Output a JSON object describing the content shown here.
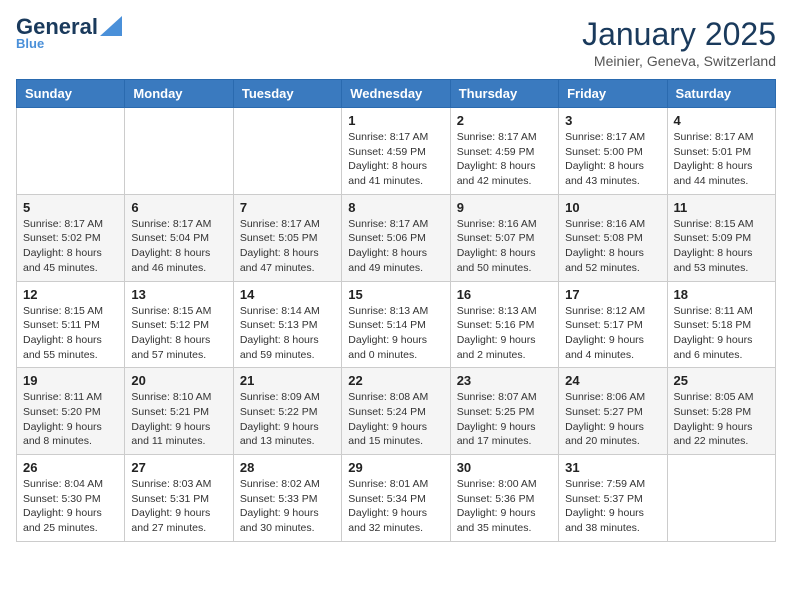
{
  "logo": {
    "general": "General",
    "blue": "Blue"
  },
  "title": "January 2025",
  "location": "Meinier, Geneva, Switzerland",
  "days_of_week": [
    "Sunday",
    "Monday",
    "Tuesday",
    "Wednesday",
    "Thursday",
    "Friday",
    "Saturday"
  ],
  "weeks": [
    [
      {
        "day": "",
        "sunrise": "",
        "sunset": "",
        "daylight": ""
      },
      {
        "day": "",
        "sunrise": "",
        "sunset": "",
        "daylight": ""
      },
      {
        "day": "",
        "sunrise": "",
        "sunset": "",
        "daylight": ""
      },
      {
        "day": "1",
        "sunrise": "Sunrise: 8:17 AM",
        "sunset": "Sunset: 4:59 PM",
        "daylight": "Daylight: 8 hours and 41 minutes."
      },
      {
        "day": "2",
        "sunrise": "Sunrise: 8:17 AM",
        "sunset": "Sunset: 4:59 PM",
        "daylight": "Daylight: 8 hours and 42 minutes."
      },
      {
        "day": "3",
        "sunrise": "Sunrise: 8:17 AM",
        "sunset": "Sunset: 5:00 PM",
        "daylight": "Daylight: 8 hours and 43 minutes."
      },
      {
        "day": "4",
        "sunrise": "Sunrise: 8:17 AM",
        "sunset": "Sunset: 5:01 PM",
        "daylight": "Daylight: 8 hours and 44 minutes."
      }
    ],
    [
      {
        "day": "5",
        "sunrise": "Sunrise: 8:17 AM",
        "sunset": "Sunset: 5:02 PM",
        "daylight": "Daylight: 8 hours and 45 minutes."
      },
      {
        "day": "6",
        "sunrise": "Sunrise: 8:17 AM",
        "sunset": "Sunset: 5:04 PM",
        "daylight": "Daylight: 8 hours and 46 minutes."
      },
      {
        "day": "7",
        "sunrise": "Sunrise: 8:17 AM",
        "sunset": "Sunset: 5:05 PM",
        "daylight": "Daylight: 8 hours and 47 minutes."
      },
      {
        "day": "8",
        "sunrise": "Sunrise: 8:17 AM",
        "sunset": "Sunset: 5:06 PM",
        "daylight": "Daylight: 8 hours and 49 minutes."
      },
      {
        "day": "9",
        "sunrise": "Sunrise: 8:16 AM",
        "sunset": "Sunset: 5:07 PM",
        "daylight": "Daylight: 8 hours and 50 minutes."
      },
      {
        "day": "10",
        "sunrise": "Sunrise: 8:16 AM",
        "sunset": "Sunset: 5:08 PM",
        "daylight": "Daylight: 8 hours and 52 minutes."
      },
      {
        "day": "11",
        "sunrise": "Sunrise: 8:15 AM",
        "sunset": "Sunset: 5:09 PM",
        "daylight": "Daylight: 8 hours and 53 minutes."
      }
    ],
    [
      {
        "day": "12",
        "sunrise": "Sunrise: 8:15 AM",
        "sunset": "Sunset: 5:11 PM",
        "daylight": "Daylight: 8 hours and 55 minutes."
      },
      {
        "day": "13",
        "sunrise": "Sunrise: 8:15 AM",
        "sunset": "Sunset: 5:12 PM",
        "daylight": "Daylight: 8 hours and 57 minutes."
      },
      {
        "day": "14",
        "sunrise": "Sunrise: 8:14 AM",
        "sunset": "Sunset: 5:13 PM",
        "daylight": "Daylight: 8 hours and 59 minutes."
      },
      {
        "day": "15",
        "sunrise": "Sunrise: 8:13 AM",
        "sunset": "Sunset: 5:14 PM",
        "daylight": "Daylight: 9 hours and 0 minutes."
      },
      {
        "day": "16",
        "sunrise": "Sunrise: 8:13 AM",
        "sunset": "Sunset: 5:16 PM",
        "daylight": "Daylight: 9 hours and 2 minutes."
      },
      {
        "day": "17",
        "sunrise": "Sunrise: 8:12 AM",
        "sunset": "Sunset: 5:17 PM",
        "daylight": "Daylight: 9 hours and 4 minutes."
      },
      {
        "day": "18",
        "sunrise": "Sunrise: 8:11 AM",
        "sunset": "Sunset: 5:18 PM",
        "daylight": "Daylight: 9 hours and 6 minutes."
      }
    ],
    [
      {
        "day": "19",
        "sunrise": "Sunrise: 8:11 AM",
        "sunset": "Sunset: 5:20 PM",
        "daylight": "Daylight: 9 hours and 8 minutes."
      },
      {
        "day": "20",
        "sunrise": "Sunrise: 8:10 AM",
        "sunset": "Sunset: 5:21 PM",
        "daylight": "Daylight: 9 hours and 11 minutes."
      },
      {
        "day": "21",
        "sunrise": "Sunrise: 8:09 AM",
        "sunset": "Sunset: 5:22 PM",
        "daylight": "Daylight: 9 hours and 13 minutes."
      },
      {
        "day": "22",
        "sunrise": "Sunrise: 8:08 AM",
        "sunset": "Sunset: 5:24 PM",
        "daylight": "Daylight: 9 hours and 15 minutes."
      },
      {
        "day": "23",
        "sunrise": "Sunrise: 8:07 AM",
        "sunset": "Sunset: 5:25 PM",
        "daylight": "Daylight: 9 hours and 17 minutes."
      },
      {
        "day": "24",
        "sunrise": "Sunrise: 8:06 AM",
        "sunset": "Sunset: 5:27 PM",
        "daylight": "Daylight: 9 hours and 20 minutes."
      },
      {
        "day": "25",
        "sunrise": "Sunrise: 8:05 AM",
        "sunset": "Sunset: 5:28 PM",
        "daylight": "Daylight: 9 hours and 22 minutes."
      }
    ],
    [
      {
        "day": "26",
        "sunrise": "Sunrise: 8:04 AM",
        "sunset": "Sunset: 5:30 PM",
        "daylight": "Daylight: 9 hours and 25 minutes."
      },
      {
        "day": "27",
        "sunrise": "Sunrise: 8:03 AM",
        "sunset": "Sunset: 5:31 PM",
        "daylight": "Daylight: 9 hours and 27 minutes."
      },
      {
        "day": "28",
        "sunrise": "Sunrise: 8:02 AM",
        "sunset": "Sunset: 5:33 PM",
        "daylight": "Daylight: 9 hours and 30 minutes."
      },
      {
        "day": "29",
        "sunrise": "Sunrise: 8:01 AM",
        "sunset": "Sunset: 5:34 PM",
        "daylight": "Daylight: 9 hours and 32 minutes."
      },
      {
        "day": "30",
        "sunrise": "Sunrise: 8:00 AM",
        "sunset": "Sunset: 5:36 PM",
        "daylight": "Daylight: 9 hours and 35 minutes."
      },
      {
        "day": "31",
        "sunrise": "Sunrise: 7:59 AM",
        "sunset": "Sunset: 5:37 PM",
        "daylight": "Daylight: 9 hours and 38 minutes."
      },
      {
        "day": "",
        "sunrise": "",
        "sunset": "",
        "daylight": ""
      }
    ]
  ]
}
